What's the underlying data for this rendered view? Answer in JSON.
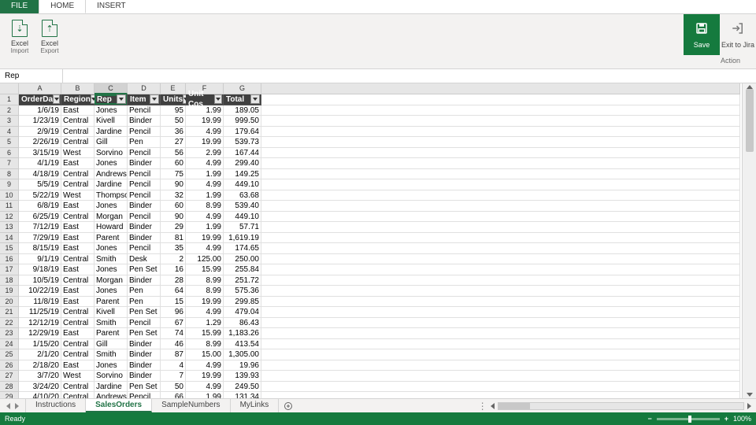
{
  "ribbon": {
    "tabs": {
      "file": "FILE",
      "home": "HOME",
      "insert": "INSERT"
    },
    "excel_label": "Excel",
    "import_label": "Import",
    "export_label": "Export",
    "save_label": "Save",
    "exit_label": "Exit to Jira",
    "action_group": "Action"
  },
  "namebox": {
    "value": "Rep"
  },
  "columns": [
    "A",
    "B",
    "C",
    "D",
    "E",
    "F",
    "G"
  ],
  "selected_column": "C",
  "headers": [
    "OrderDa",
    "Region",
    "Rep",
    "Item",
    "Units",
    "Unit Cos",
    "Total"
  ],
  "rows": [
    {
      "n": 2,
      "date": "1/6/19",
      "region": "East",
      "rep": "Jones",
      "item": "Pencil",
      "units": "95",
      "cost": "1.99",
      "total": "189.05"
    },
    {
      "n": 3,
      "date": "1/23/19",
      "region": "Central",
      "rep": "Kivell",
      "item": "Binder",
      "units": "50",
      "cost": "19.99",
      "total": "999.50"
    },
    {
      "n": 4,
      "date": "2/9/19",
      "region": "Central",
      "rep": "Jardine",
      "item": "Pencil",
      "units": "36",
      "cost": "4.99",
      "total": "179.64"
    },
    {
      "n": 5,
      "date": "2/26/19",
      "region": "Central",
      "rep": "Gill",
      "item": "Pen",
      "units": "27",
      "cost": "19.99",
      "total": "539.73"
    },
    {
      "n": 6,
      "date": "3/15/19",
      "region": "West",
      "rep": "Sorvino",
      "item": "Pencil",
      "units": "56",
      "cost": "2.99",
      "total": "167.44"
    },
    {
      "n": 7,
      "date": "4/1/19",
      "region": "East",
      "rep": "Jones",
      "item": "Binder",
      "units": "60",
      "cost": "4.99",
      "total": "299.40"
    },
    {
      "n": 8,
      "date": "4/18/19",
      "region": "Central",
      "rep": "Andrews",
      "item": "Pencil",
      "units": "75",
      "cost": "1.99",
      "total": "149.25"
    },
    {
      "n": 9,
      "date": "5/5/19",
      "region": "Central",
      "rep": "Jardine",
      "item": "Pencil",
      "units": "90",
      "cost": "4.99",
      "total": "449.10"
    },
    {
      "n": 10,
      "date": "5/22/19",
      "region": "West",
      "rep": "Thompson",
      "item": "Pencil",
      "units": "32",
      "cost": "1.99",
      "total": "63.68"
    },
    {
      "n": 11,
      "date": "6/8/19",
      "region": "East",
      "rep": "Jones",
      "item": "Binder",
      "units": "60",
      "cost": "8.99",
      "total": "539.40"
    },
    {
      "n": 12,
      "date": "6/25/19",
      "region": "Central",
      "rep": "Morgan",
      "item": "Pencil",
      "units": "90",
      "cost": "4.99",
      "total": "449.10"
    },
    {
      "n": 13,
      "date": "7/12/19",
      "region": "East",
      "rep": "Howard",
      "item": "Binder",
      "units": "29",
      "cost": "1.99",
      "total": "57.71"
    },
    {
      "n": 14,
      "date": "7/29/19",
      "region": "East",
      "rep": "Parent",
      "item": "Binder",
      "units": "81",
      "cost": "19.99",
      "total": "1,619.19"
    },
    {
      "n": 15,
      "date": "8/15/19",
      "region": "East",
      "rep": "Jones",
      "item": "Pencil",
      "units": "35",
      "cost": "4.99",
      "total": "174.65"
    },
    {
      "n": 16,
      "date": "9/1/19",
      "region": "Central",
      "rep": "Smith",
      "item": "Desk",
      "units": "2",
      "cost": "125.00",
      "total": "250.00"
    },
    {
      "n": 17,
      "date": "9/18/19",
      "region": "East",
      "rep": "Jones",
      "item": "Pen Set",
      "units": "16",
      "cost": "15.99",
      "total": "255.84"
    },
    {
      "n": 18,
      "date": "10/5/19",
      "region": "Central",
      "rep": "Morgan",
      "item": "Binder",
      "units": "28",
      "cost": "8.99",
      "total": "251.72"
    },
    {
      "n": 19,
      "date": "10/22/19",
      "region": "East",
      "rep": "Jones",
      "item": "Pen",
      "units": "64",
      "cost": "8.99",
      "total": "575.36"
    },
    {
      "n": 20,
      "date": "11/8/19",
      "region": "East",
      "rep": "Parent",
      "item": "Pen",
      "units": "15",
      "cost": "19.99",
      "total": "299.85"
    },
    {
      "n": 21,
      "date": "11/25/19",
      "region": "Central",
      "rep": "Kivell",
      "item": "Pen Set",
      "units": "96",
      "cost": "4.99",
      "total": "479.04"
    },
    {
      "n": 22,
      "date": "12/12/19",
      "region": "Central",
      "rep": "Smith",
      "item": "Pencil",
      "units": "67",
      "cost": "1.29",
      "total": "86.43"
    },
    {
      "n": 23,
      "date": "12/29/19",
      "region": "East",
      "rep": "Parent",
      "item": "Pen Set",
      "units": "74",
      "cost": "15.99",
      "total": "1,183.26"
    },
    {
      "n": 24,
      "date": "1/15/20",
      "region": "Central",
      "rep": "Gill",
      "item": "Binder",
      "units": "46",
      "cost": "8.99",
      "total": "413.54"
    },
    {
      "n": 25,
      "date": "2/1/20",
      "region": "Central",
      "rep": "Smith",
      "item": "Binder",
      "units": "87",
      "cost": "15.00",
      "total": "1,305.00"
    },
    {
      "n": 26,
      "date": "2/18/20",
      "region": "East",
      "rep": "Jones",
      "item": "Binder",
      "units": "4",
      "cost": "4.99",
      "total": "19.96"
    },
    {
      "n": 27,
      "date": "3/7/20",
      "region": "West",
      "rep": "Sorvino",
      "item": "Binder",
      "units": "7",
      "cost": "19.99",
      "total": "139.93"
    },
    {
      "n": 28,
      "date": "3/24/20",
      "region": "Central",
      "rep": "Jardine",
      "item": "Pen Set",
      "units": "50",
      "cost": "4.99",
      "total": "249.50"
    },
    {
      "n": 29,
      "date": "4/10/20",
      "region": "Central",
      "rep": "Andrews",
      "item": "Pencil",
      "units": "66",
      "cost": "1.99",
      "total": "131.34"
    }
  ],
  "sheets": {
    "tabs": [
      "Instructions",
      "SalesOrders",
      "SampleNumbers",
      "MyLinks"
    ],
    "active": "SalesOrders"
  },
  "statusbar": {
    "ready": "Ready",
    "zoom": "100%"
  }
}
